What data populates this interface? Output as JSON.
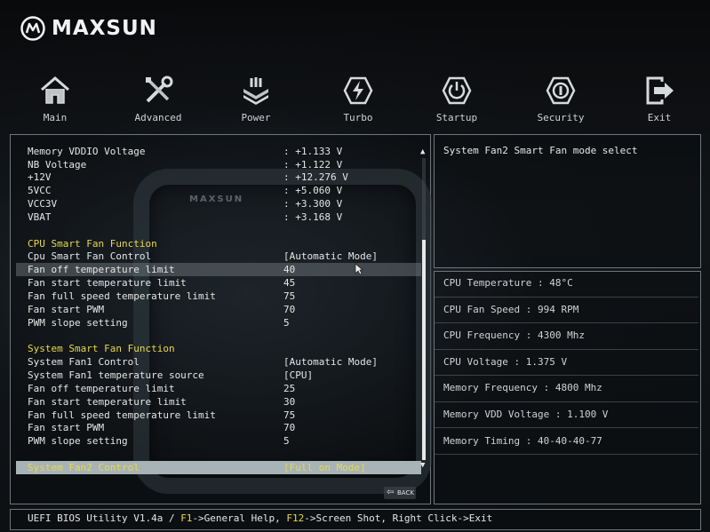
{
  "brand": {
    "name": "MAXSUN"
  },
  "nav": [
    {
      "label": "Main",
      "icon": "home-icon"
    },
    {
      "label": "Advanced",
      "icon": "tools-icon"
    },
    {
      "label": "Power",
      "icon": "chip-icon"
    },
    {
      "label": "Turbo",
      "icon": "lightning-icon"
    },
    {
      "label": "Startup",
      "icon": "power-icon"
    },
    {
      "label": "Security",
      "icon": "shield-icon"
    },
    {
      "label": "Exit",
      "icon": "exit-icon"
    }
  ],
  "settings": [
    {
      "label": "Memory VDDIO Voltage",
      "value": ": +1.133 V"
    },
    {
      "label": "NB Voltage",
      "value": ": +1.122 V"
    },
    {
      "label": "+12V",
      "value": ": +12.276 V"
    },
    {
      "label": "5VCC",
      "value": ": +5.060 V"
    },
    {
      "label": "VCC3V",
      "value": ": +3.300 V"
    },
    {
      "label": "VBAT",
      "value": ": +3.168 V"
    },
    {
      "label": "CPU Smart Fan Function",
      "value": ""
    },
    {
      "label": "Cpu Smart Fan Control",
      "value": "[Automatic Mode]"
    },
    {
      "label": "Fan off temperature limit",
      "value": "40"
    },
    {
      "label": "Fan start temperature limit",
      "value": "45"
    },
    {
      "label": "Fan full speed temperature limit",
      "value": "75"
    },
    {
      "label": "Fan start PWM",
      "value": "70"
    },
    {
      "label": "PWM slope setting",
      "value": "5"
    },
    {
      "label": "System Smart Fan Function",
      "value": ""
    },
    {
      "label": "System Fan1 Control",
      "value": "[Automatic Mode]"
    },
    {
      "label": "System Fan1 temperature source",
      "value": "[CPU]"
    },
    {
      "label": "Fan off temperature limit",
      "value": "25"
    },
    {
      "label": "Fan start temperature limit",
      "value": "30"
    },
    {
      "label": "Fan full speed temperature limit",
      "value": "75"
    },
    {
      "label": "Fan start PWM",
      "value": "70"
    },
    {
      "label": "PWM slope setting",
      "value": "5"
    },
    {
      "label": "System Fan2 Control",
      "value": "[Full on Mode]"
    }
  ],
  "deco_label": "MAXSUN",
  "back_label": "BACK",
  "help": {
    "text": "System Fan2 Smart Fan mode select"
  },
  "info": [
    {
      "text": "CPU Temperature : 48°C"
    },
    {
      "text": "CPU Fan Speed : 994 RPM"
    },
    {
      "text": "CPU Frequency : 4300 Mhz"
    },
    {
      "text": "CPU Voltage : 1.375 V"
    },
    {
      "text": "Memory Frequency : 4800 Mhz"
    },
    {
      "text": "Memory VDD Voltage : 1.100 V"
    },
    {
      "text": "Memory Timing : 40-40-40-77"
    }
  ],
  "footer": {
    "prefix": "UEFI BIOS Utility V1.4a / ",
    "f1_key": "F1",
    "f1_text": "->General Help, ",
    "f12_key": "F12",
    "f12_text": "->Screen Shot, Right Click->Exit"
  },
  "colors": {
    "highlight": "#e8d94a",
    "selected_bg": "#a7b3b6",
    "border": "#6e767c"
  }
}
